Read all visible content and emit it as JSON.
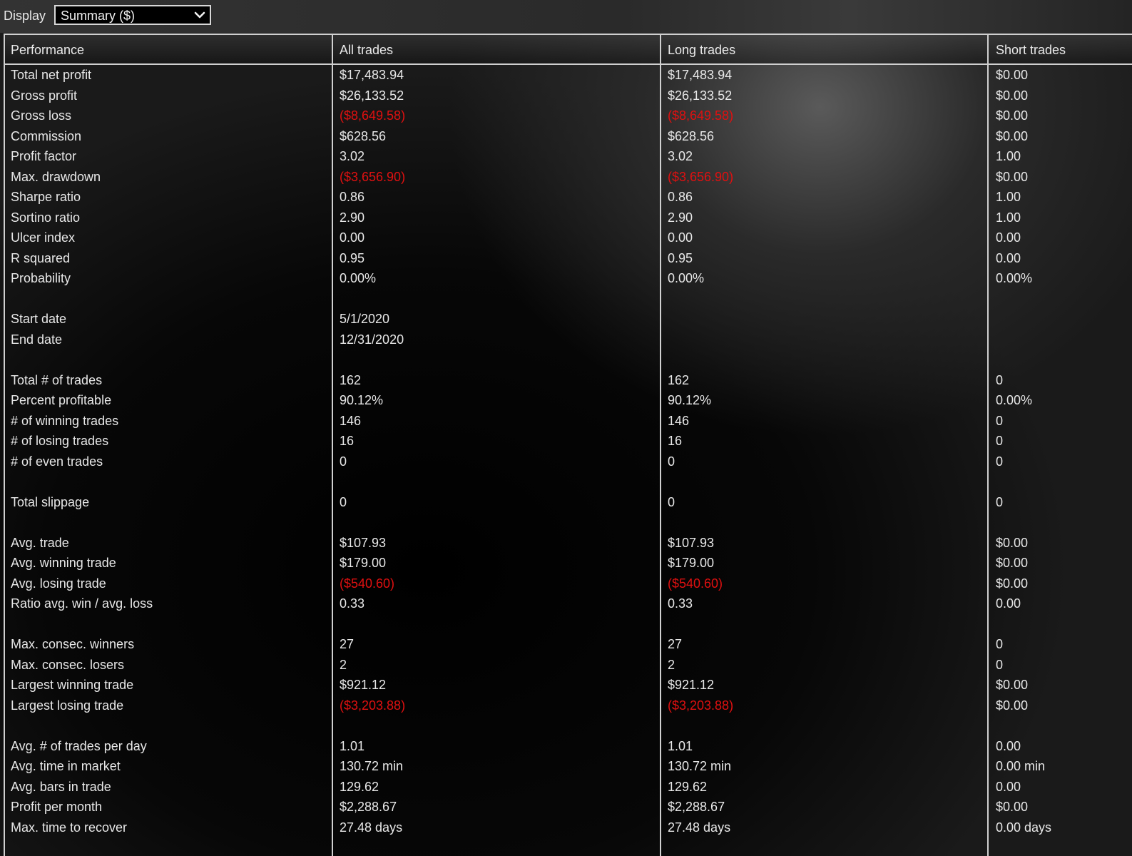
{
  "toolbar": {
    "display_label": "Display",
    "display_value": "Summary ($)"
  },
  "table": {
    "headers": [
      "Performance",
      "All trades",
      "Long trades",
      "Short trades"
    ],
    "rows": [
      {
        "label": "Total net profit",
        "all": "$17,483.94",
        "long": "$17,483.94",
        "short": "$0.00"
      },
      {
        "label": "Gross profit",
        "all": "$26,133.52",
        "long": "$26,133.52",
        "short": "$0.00"
      },
      {
        "label": "Gross loss",
        "all": "($8,649.58)",
        "long": "($8,649.58)",
        "short": "$0.00",
        "negative": true
      },
      {
        "label": "Commission",
        "all": "$628.56",
        "long": "$628.56",
        "short": "$0.00"
      },
      {
        "label": "Profit factor",
        "all": "3.02",
        "long": "3.02",
        "short": "1.00"
      },
      {
        "label": "Max. drawdown",
        "all": "($3,656.90)",
        "long": "($3,656.90)",
        "short": "$0.00",
        "negative": true
      },
      {
        "label": "Sharpe ratio",
        "all": "0.86",
        "long": "0.86",
        "short": "1.00"
      },
      {
        "label": "Sortino ratio",
        "all": "2.90",
        "long": "2.90",
        "short": "1.00"
      },
      {
        "label": "Ulcer index",
        "all": "0.00",
        "long": "0.00",
        "short": "0.00"
      },
      {
        "label": "R squared",
        "all": "0.95",
        "long": "0.95",
        "short": "0.00"
      },
      {
        "label": "Probability",
        "all": "0.00%",
        "long": "0.00%",
        "short": "0.00%"
      },
      {
        "gap": true
      },
      {
        "label": "Start date",
        "all": "5/1/2020",
        "long": "",
        "short": ""
      },
      {
        "label": "End date",
        "all": "12/31/2020",
        "long": "",
        "short": ""
      },
      {
        "gap": true
      },
      {
        "label": "Total # of trades",
        "all": "162",
        "long": "162",
        "short": "0"
      },
      {
        "label": "Percent profitable",
        "all": "90.12%",
        "long": "90.12%",
        "short": "0.00%"
      },
      {
        "label": "# of winning trades",
        "all": "146",
        "long": "146",
        "short": "0"
      },
      {
        "label": "# of losing trades",
        "all": "16",
        "long": "16",
        "short": "0"
      },
      {
        "label": "# of even trades",
        "all": "0",
        "long": "0",
        "short": "0"
      },
      {
        "gap": true
      },
      {
        "label": "Total slippage",
        "all": "0",
        "long": "0",
        "short": "0"
      },
      {
        "gap": true
      },
      {
        "label": "Avg. trade",
        "all": "$107.93",
        "long": "$107.93",
        "short": "$0.00"
      },
      {
        "label": "Avg. winning trade",
        "all": "$179.00",
        "long": "$179.00",
        "short": "$0.00"
      },
      {
        "label": "Avg. losing trade",
        "all": "($540.60)",
        "long": "($540.60)",
        "short": "$0.00",
        "negative": true
      },
      {
        "label": "Ratio avg. win / avg. loss",
        "all": "0.33",
        "long": "0.33",
        "short": "0.00"
      },
      {
        "gap": true
      },
      {
        "label": "Max. consec. winners",
        "all": "27",
        "long": "27",
        "short": "0"
      },
      {
        "label": "Max. consec. losers",
        "all": "2",
        "long": "2",
        "short": "0"
      },
      {
        "label": "Largest winning trade",
        "all": "$921.12",
        "long": "$921.12",
        "short": "$0.00"
      },
      {
        "label": "Largest losing trade",
        "all": "($3,203.88)",
        "long": "($3,203.88)",
        "short": "$0.00",
        "negative": true
      },
      {
        "gap": true
      },
      {
        "label": "Avg. # of trades per day",
        "all": "1.01",
        "long": "1.01",
        "short": "0.00"
      },
      {
        "label": "Avg. time in market",
        "all": "130.72 min",
        "long": "130.72 min",
        "short": "0.00 min"
      },
      {
        "label": "Avg. bars in trade",
        "all": "129.62",
        "long": "129.62",
        "short": "0.00"
      },
      {
        "label": "Profit per month",
        "all": "$2,288.67",
        "long": "$2,288.67",
        "short": "$0.00"
      },
      {
        "label": "Max. time to recover",
        "all": "27.48 days",
        "long": "27.48 days",
        "short": "0.00 days"
      }
    ]
  },
  "colors": {
    "negative": "#e01010",
    "text": "#e8e8e8",
    "border": "#d0d0d0"
  }
}
